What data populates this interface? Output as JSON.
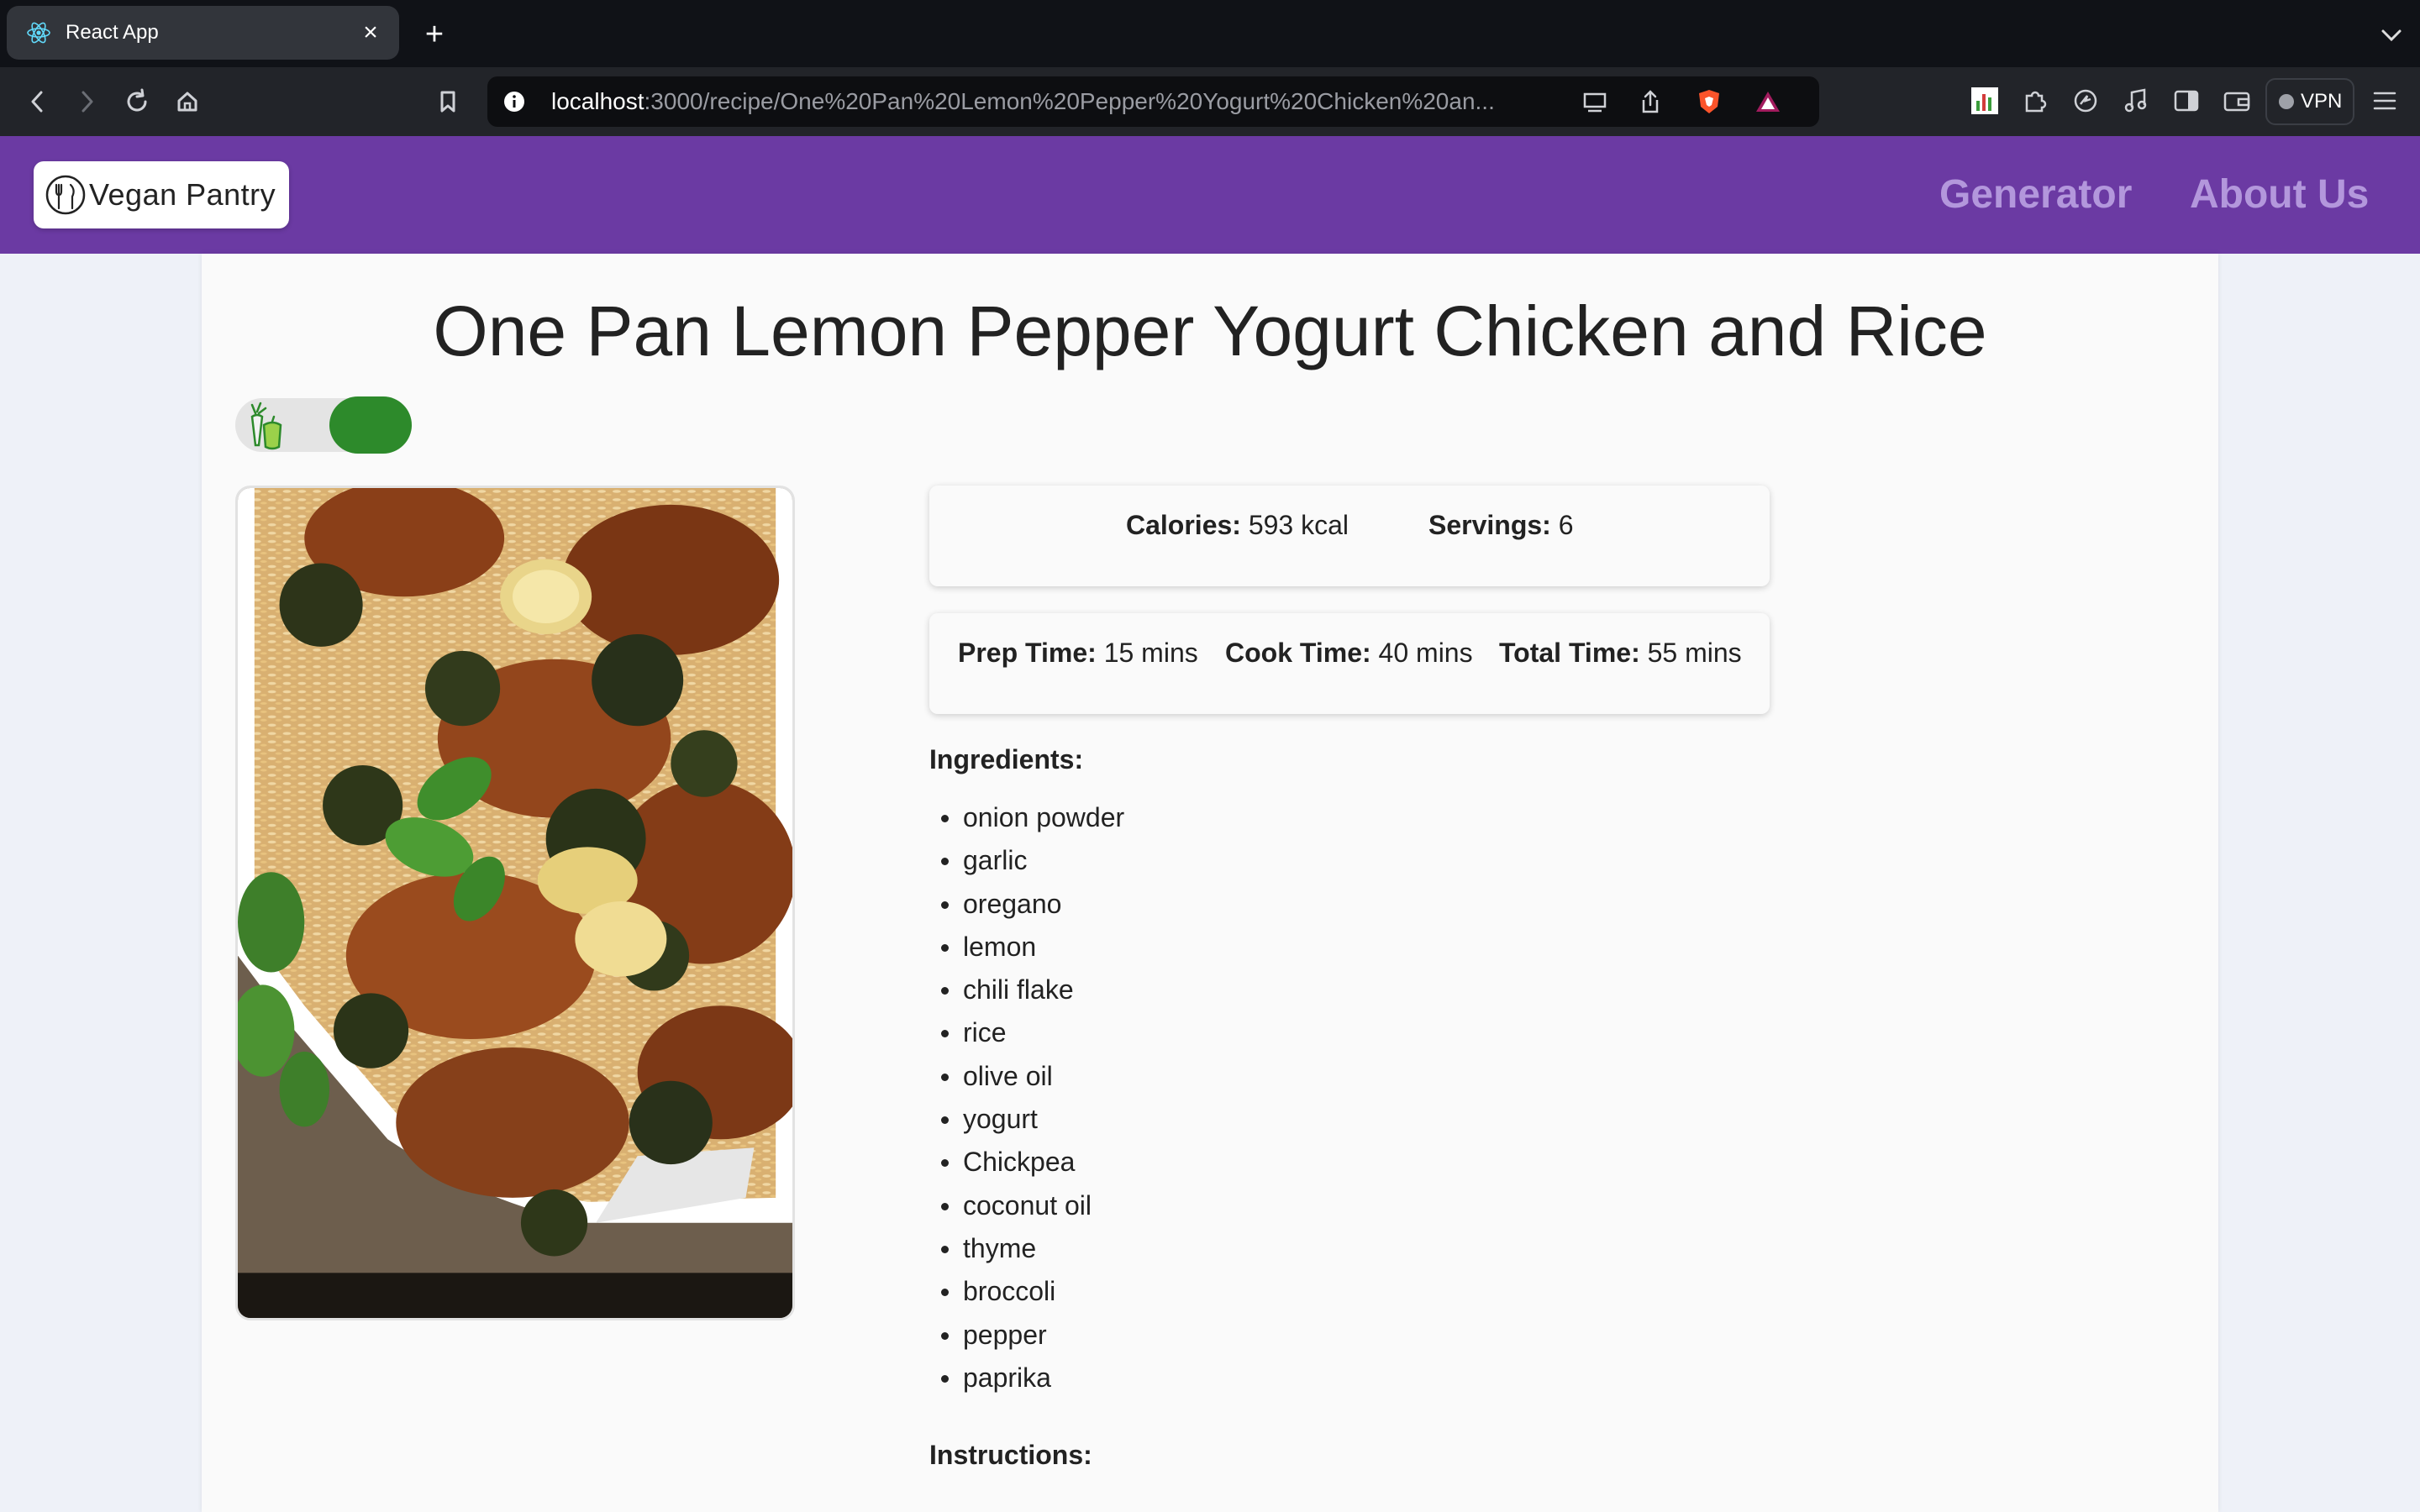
{
  "browser": {
    "tab_title": "React App",
    "url_host": "localhost",
    "url_rest": ":3000/recipe/One%20Pan%20Lemon%20Pepper%20Yogurt%20Chicken%20an...",
    "vpn_label": "VPN"
  },
  "header": {
    "logo_text": "Vegan Pantry",
    "nav": [
      "Generator",
      "About Us"
    ],
    "color": "#6b3aa3"
  },
  "recipe": {
    "title": "One Pan Lemon Pepper Yogurt Chicken and Rice",
    "vegan_toggle_on": true,
    "calories_label": "Calories:",
    "calories_value": "593 kcal",
    "servings_label": "Servings:",
    "servings_value": "6",
    "prep_label": "Prep Time:",
    "prep_value": "15 mins",
    "cook_label": "Cook Time:",
    "cook_value": "40 mins",
    "total_label": "Total Time:",
    "total_value": "55 mins",
    "ingredients_label": "Ingredients:",
    "ingredients": [
      "onion powder",
      "garlic",
      "oregano",
      "lemon",
      "chili flake",
      "rice",
      "olive oil",
      "yogurt",
      "Chickpea",
      "coconut oil",
      "thyme",
      "broccoli",
      "pepper",
      "paprika"
    ],
    "instructions_label": "Instructions:"
  }
}
